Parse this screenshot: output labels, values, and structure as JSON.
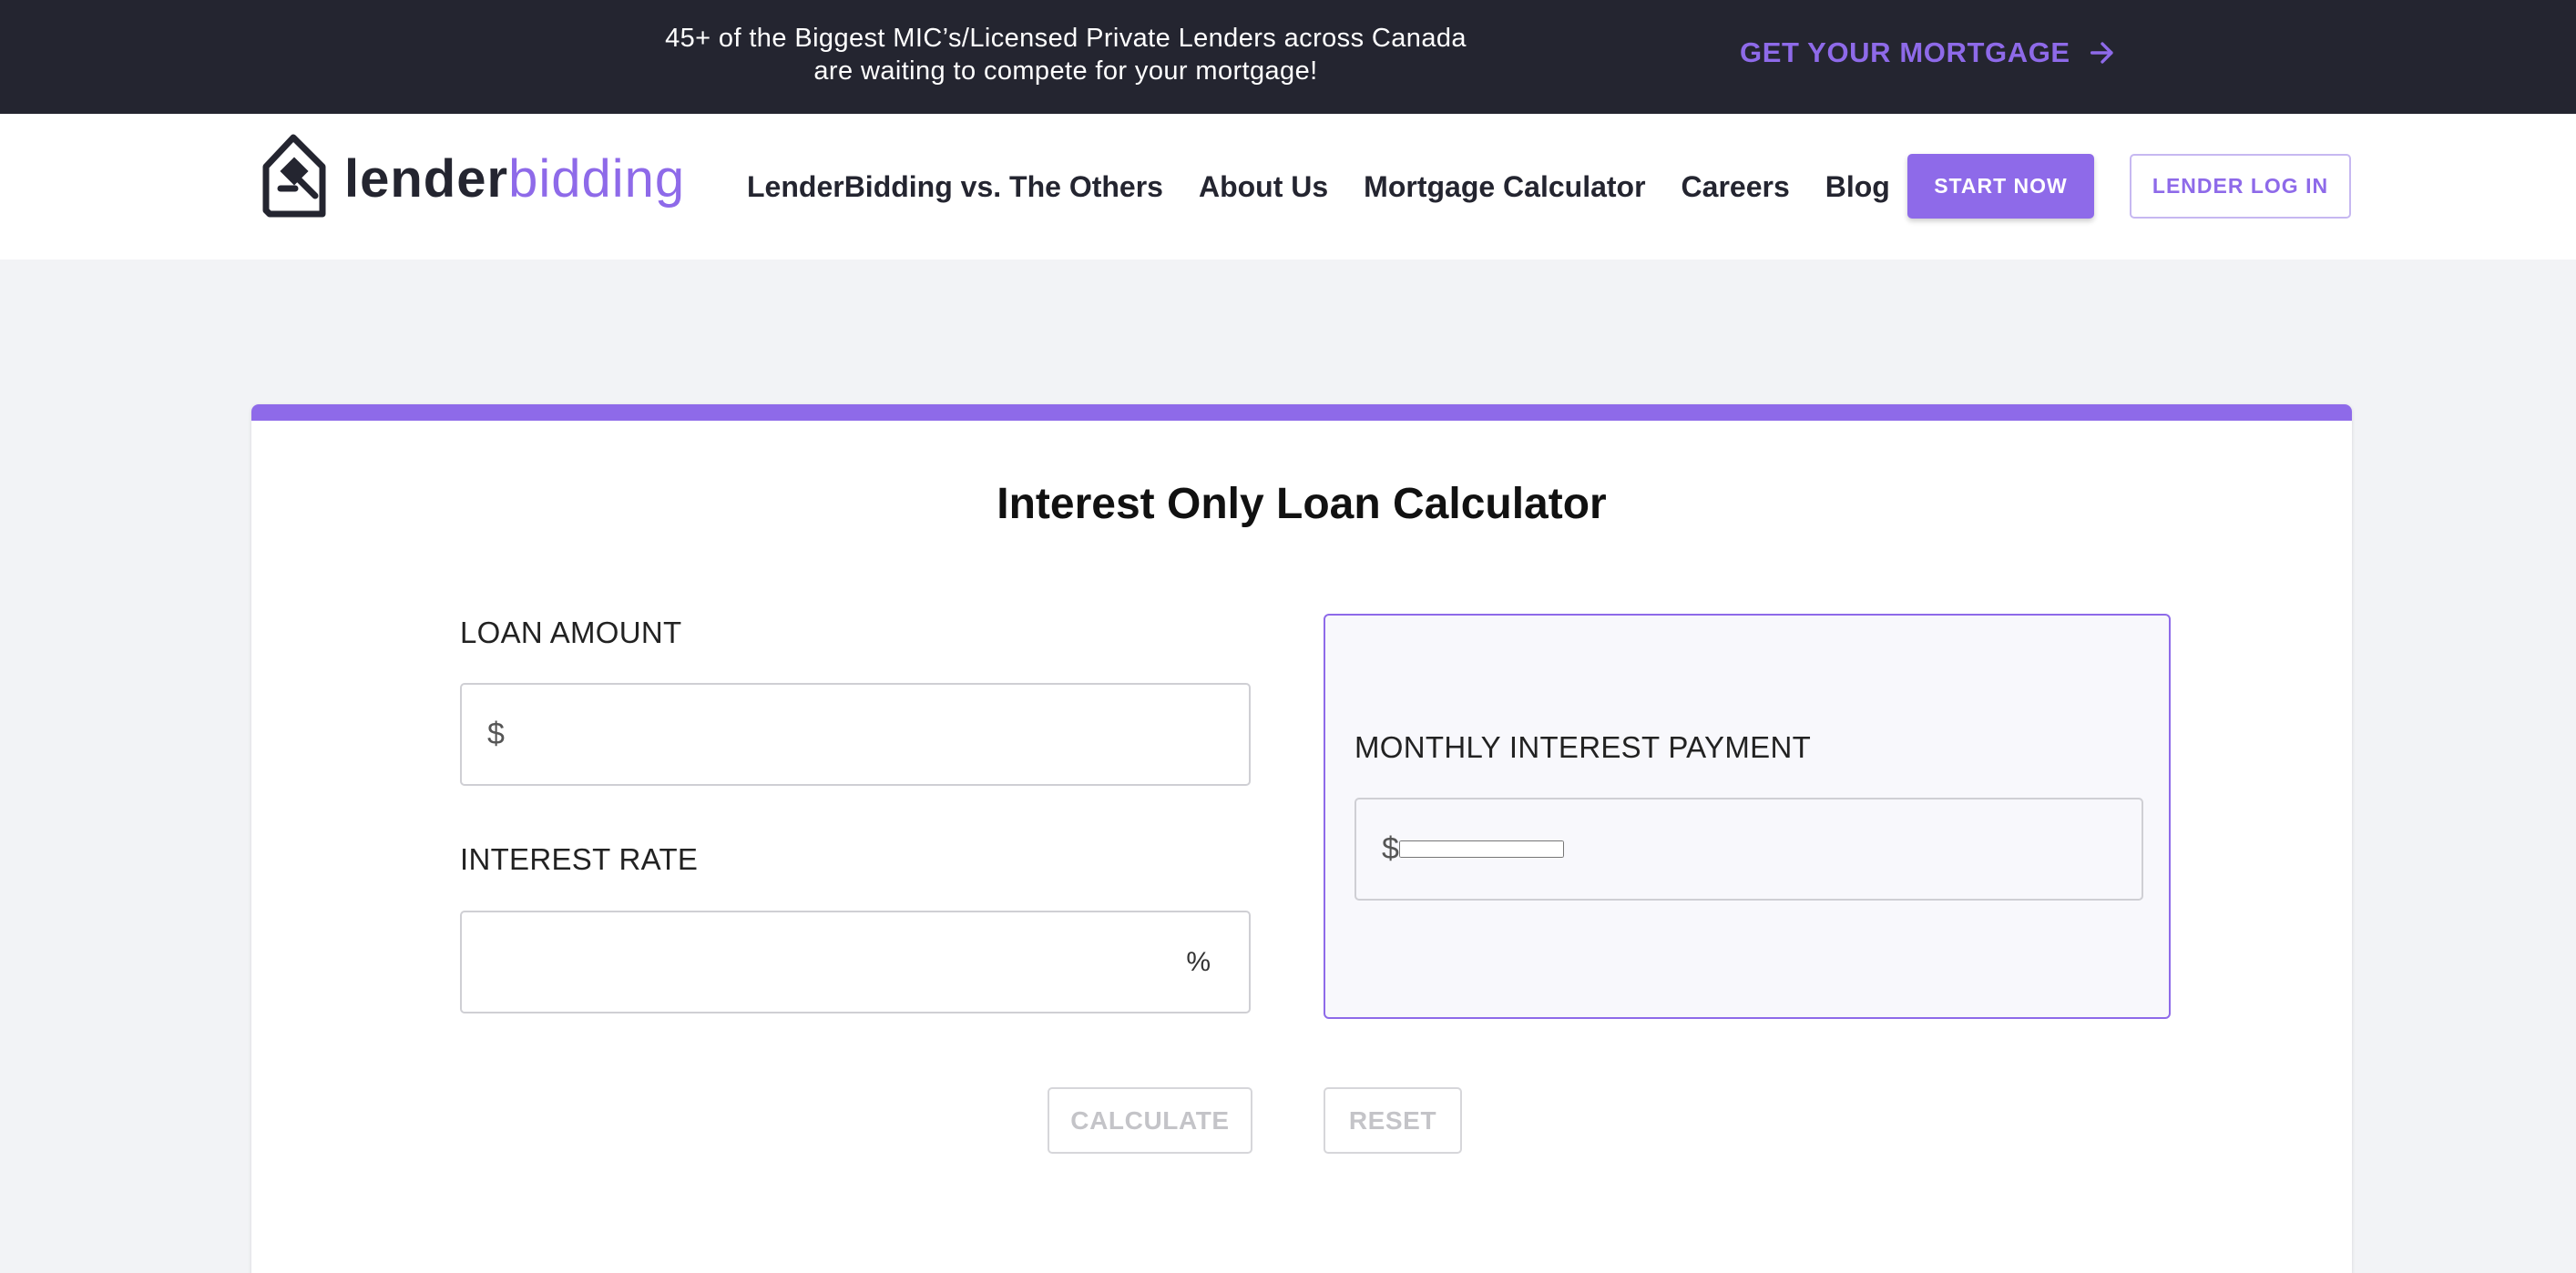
{
  "topbar": {
    "line1": "45+ of the Biggest MIC’s/Licensed Private Lenders across Canada",
    "line2": "are waiting to compete for your mortgage!",
    "cta_label": "GET YOUR MORTGAGE",
    "cta_icon": "arrow-right-icon"
  },
  "header": {
    "logo_part1": "lender",
    "logo_part2": "bidding",
    "logo_icon": "house-gavel-icon",
    "nav": [
      "LenderBidding vs. The Others",
      "About Us",
      "Mortgage Calculator",
      "Careers",
      "Blog"
    ],
    "start_label": "START NOW",
    "lender_login_label": "LENDER LOG IN"
  },
  "calculator": {
    "title": "Interest Only Loan Calculator",
    "loan_amount": {
      "label": "LOAN AMOUNT",
      "prefix": "$",
      "value": ""
    },
    "interest_rate": {
      "label": "INTEREST RATE",
      "suffix": "%",
      "value": ""
    },
    "monthly_payment": {
      "label": "MONTHLY INTEREST PAYMENT",
      "prefix": "$",
      "value": ""
    },
    "calculate_label": "CALCULATE",
    "reset_label": "RESET"
  },
  "colors": {
    "accent": "#8e6ae9",
    "topbar_bg": "#242530",
    "page_bg": "#f2f3f6"
  }
}
